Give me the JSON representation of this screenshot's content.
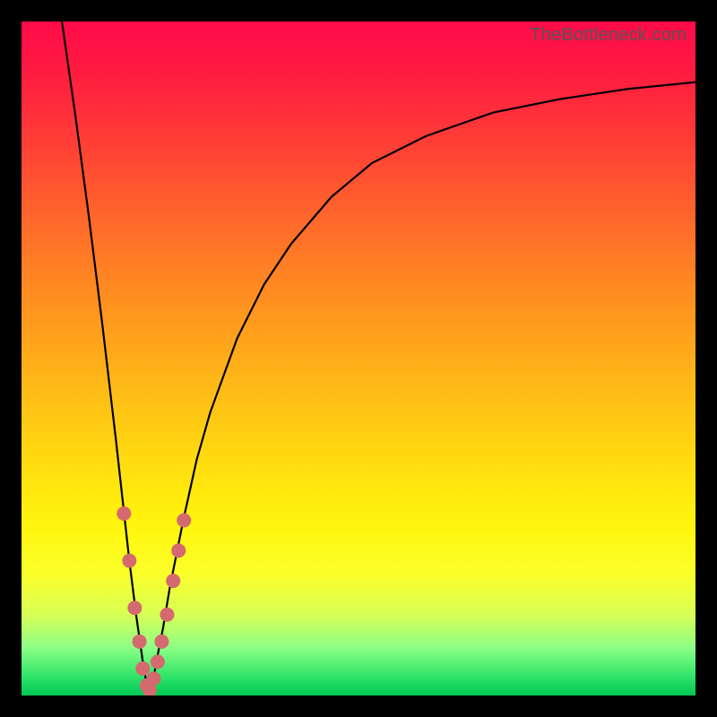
{
  "watermark": "TheBottleneck.com",
  "colors": {
    "frame": "#000000",
    "curve": "#000000",
    "marker": "#d46a6f",
    "gradient_top": "#ff0a4a",
    "gradient_bottom": "#00c853"
  },
  "chart_data": {
    "type": "line",
    "title": "",
    "xlabel": "",
    "ylabel": "",
    "xlim": [
      0,
      100
    ],
    "ylim": [
      0,
      100
    ],
    "grid": false,
    "series": [
      {
        "name": "bottleneck-curve",
        "x": [
          6,
          8,
          10,
          12,
          14,
          15,
          16,
          17,
          18,
          18.5,
          19,
          19.5,
          20,
          21,
          22,
          24,
          26,
          28,
          32,
          36,
          40,
          46,
          52,
          60,
          70,
          80,
          90,
          100
        ],
        "y": [
          100,
          86,
          71,
          55,
          38,
          29,
          20,
          12,
          5,
          2,
          0.5,
          2,
          5,
          10,
          16,
          26,
          35,
          42,
          53,
          61,
          67,
          74,
          79,
          83,
          86.5,
          88.5,
          90,
          91
        ]
      }
    ],
    "markers": {
      "name": "highlighted-points",
      "x": [
        15.2,
        16.0,
        16.8,
        17.5,
        18.0,
        18.6,
        19.0,
        19.6,
        20.2,
        20.8,
        21.6,
        22.5,
        23.3,
        24.1
      ],
      "y": [
        27,
        20,
        13,
        8,
        4,
        1.5,
        0.8,
        2.5,
        5,
        8,
        12,
        17,
        21.5,
        26
      ]
    }
  }
}
